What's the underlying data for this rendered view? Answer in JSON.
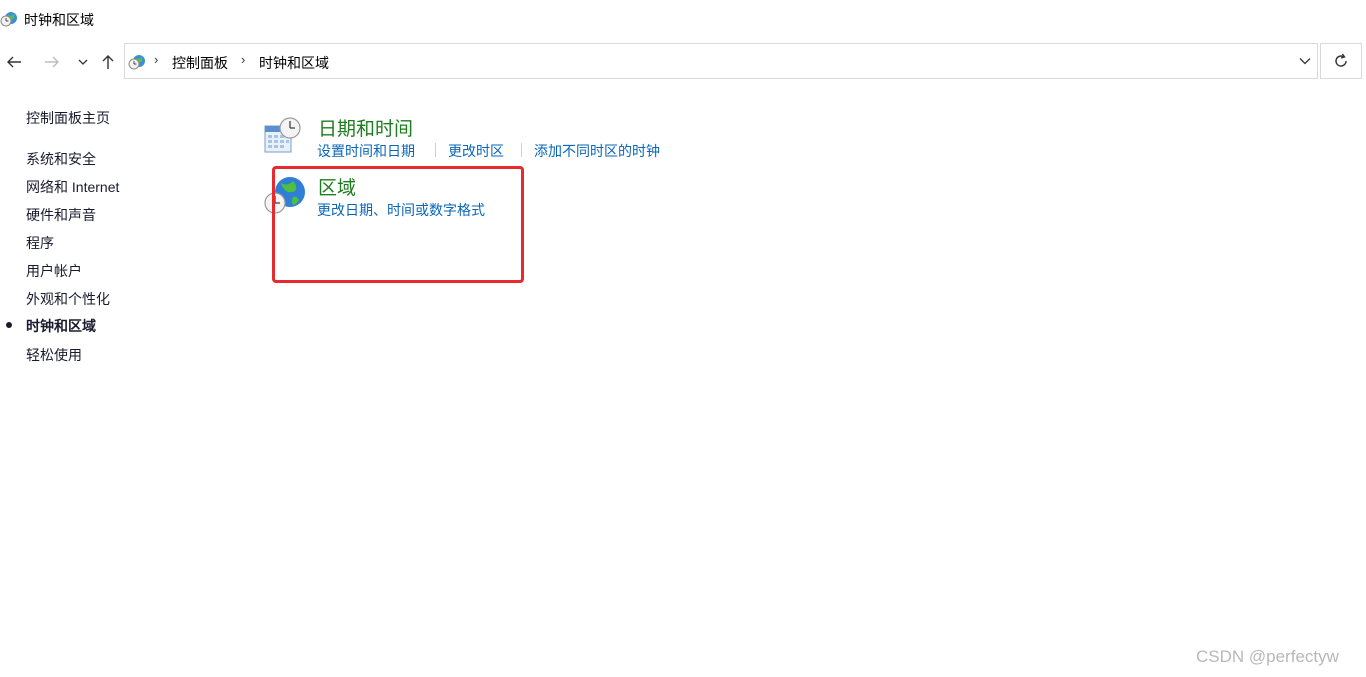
{
  "window": {
    "title": "时钟和区域",
    "icon": "clock-globe-icon"
  },
  "nav": {
    "back_icon": "back-arrow-icon",
    "forward_icon": "forward-arrow-icon",
    "recent_icon": "chevron-down-icon",
    "up_icon": "up-arrow-icon",
    "refresh_icon": "refresh-icon"
  },
  "address": {
    "breadcrumbs": [
      "控制面板",
      "时钟和区域"
    ],
    "dropdown_icon": "chevron-down-icon"
  },
  "sidebar": {
    "items": [
      {
        "label": "控制面板主页"
      },
      {
        "label": "系统和安全"
      },
      {
        "label": "网络和 Internet"
      },
      {
        "label": "硬件和声音"
      },
      {
        "label": "程序"
      },
      {
        "label": "用户帐户"
      },
      {
        "label": "外观和个性化"
      },
      {
        "label": "时钟和区域",
        "current": true
      },
      {
        "label": "轻松使用"
      }
    ]
  },
  "categories": [
    {
      "title": "日期和时间",
      "icon": "calendar-clock-icon",
      "links": [
        "设置时间和日期",
        "更改时区",
        "添加不同时区的时钟"
      ]
    },
    {
      "title": "区域",
      "icon": "globe-clock-icon",
      "links": [
        "更改日期、时间或数字格式"
      ]
    }
  ],
  "watermark": "CSDN @perfectyw",
  "colors": {
    "category_title": "#1e7d1e",
    "link": "#0a66b7",
    "highlight": "#e52b2b"
  }
}
